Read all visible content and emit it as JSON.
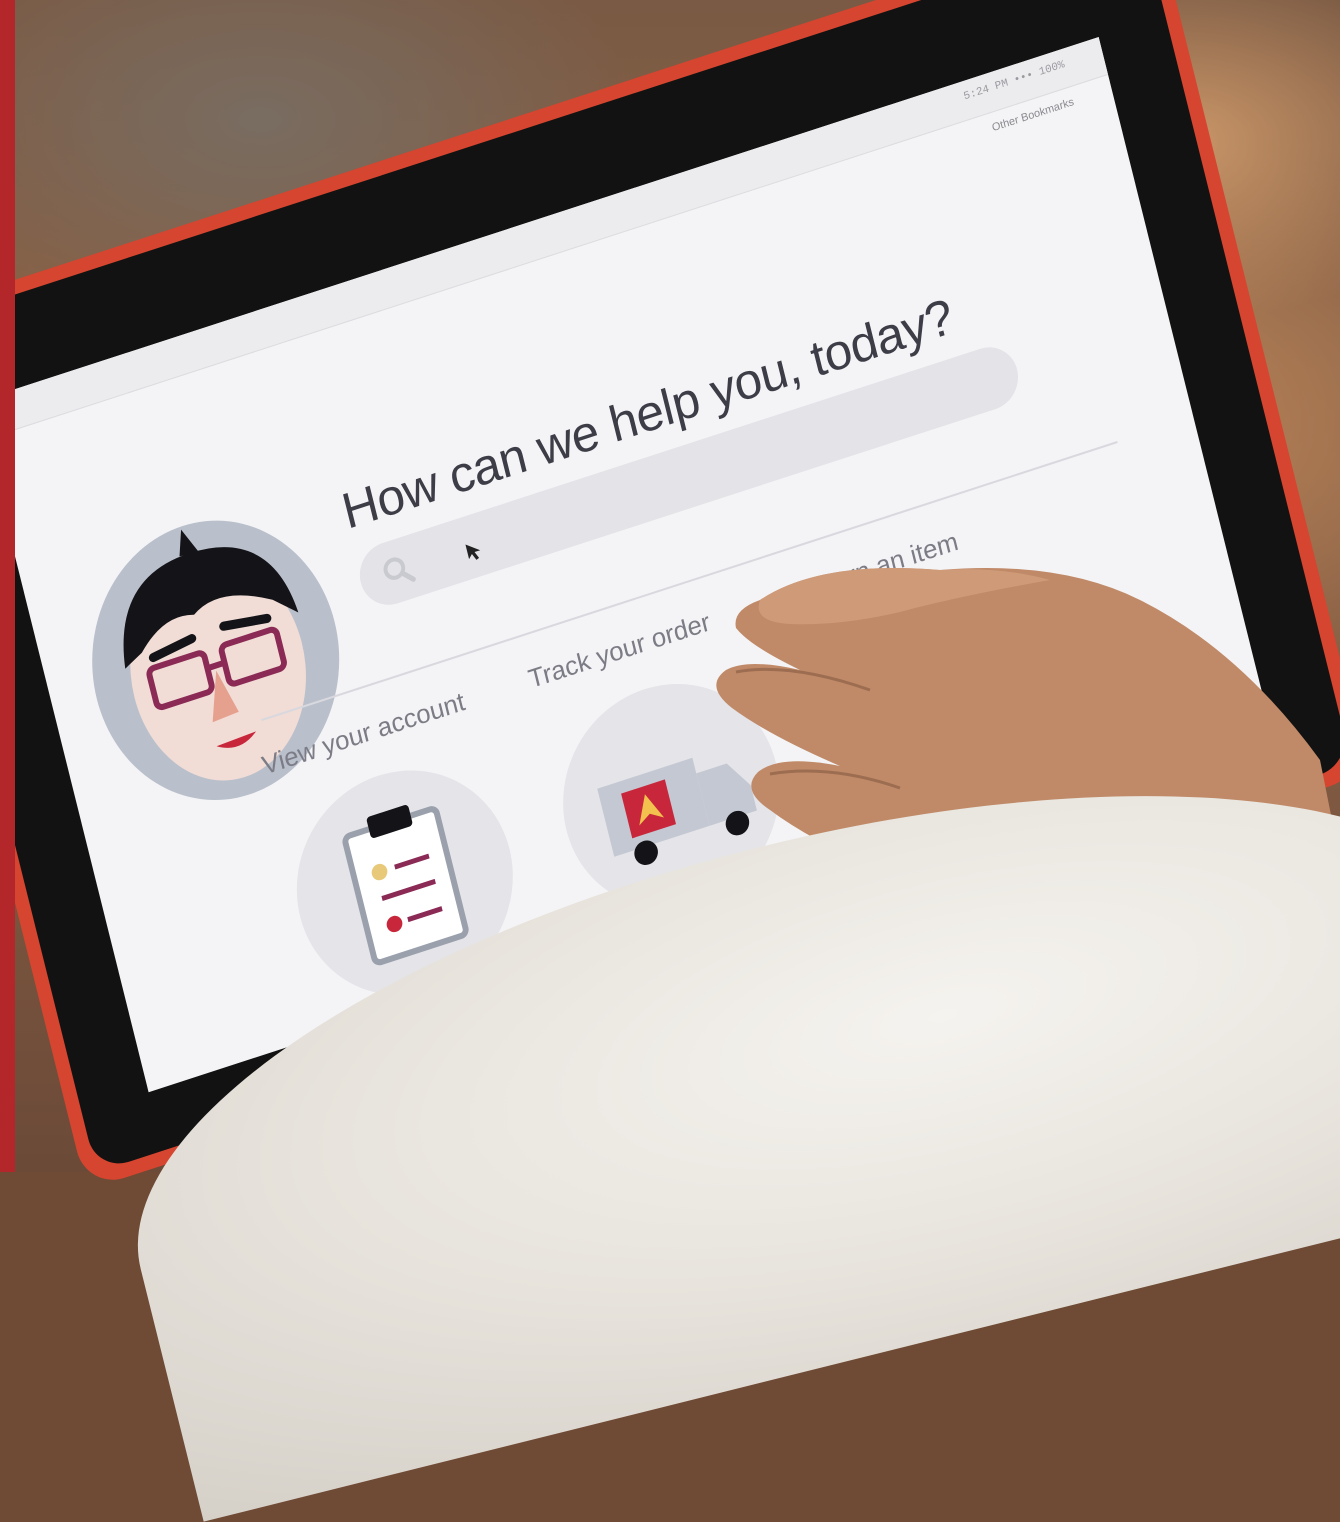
{
  "screen": {
    "status_text": "5:24 PM  ••• 100%",
    "bookmarks_label": "Other Bookmarks",
    "headline": "How can we help you, today?",
    "search": {
      "placeholder": "",
      "icon": "search-icon"
    },
    "tiles": [
      {
        "label": "View your account",
        "icon": "clipboard-icon"
      },
      {
        "label": "Track your order",
        "icon": "delivery-truck-icon"
      },
      {
        "label": "Return an item",
        "icon": "return-box-icon"
      }
    ]
  },
  "colors": {
    "accent_red": "#c8273b",
    "avatar_ring": "#b9c0cb",
    "tablet_case": "#d5452f",
    "side_strip": "#b3262a"
  }
}
